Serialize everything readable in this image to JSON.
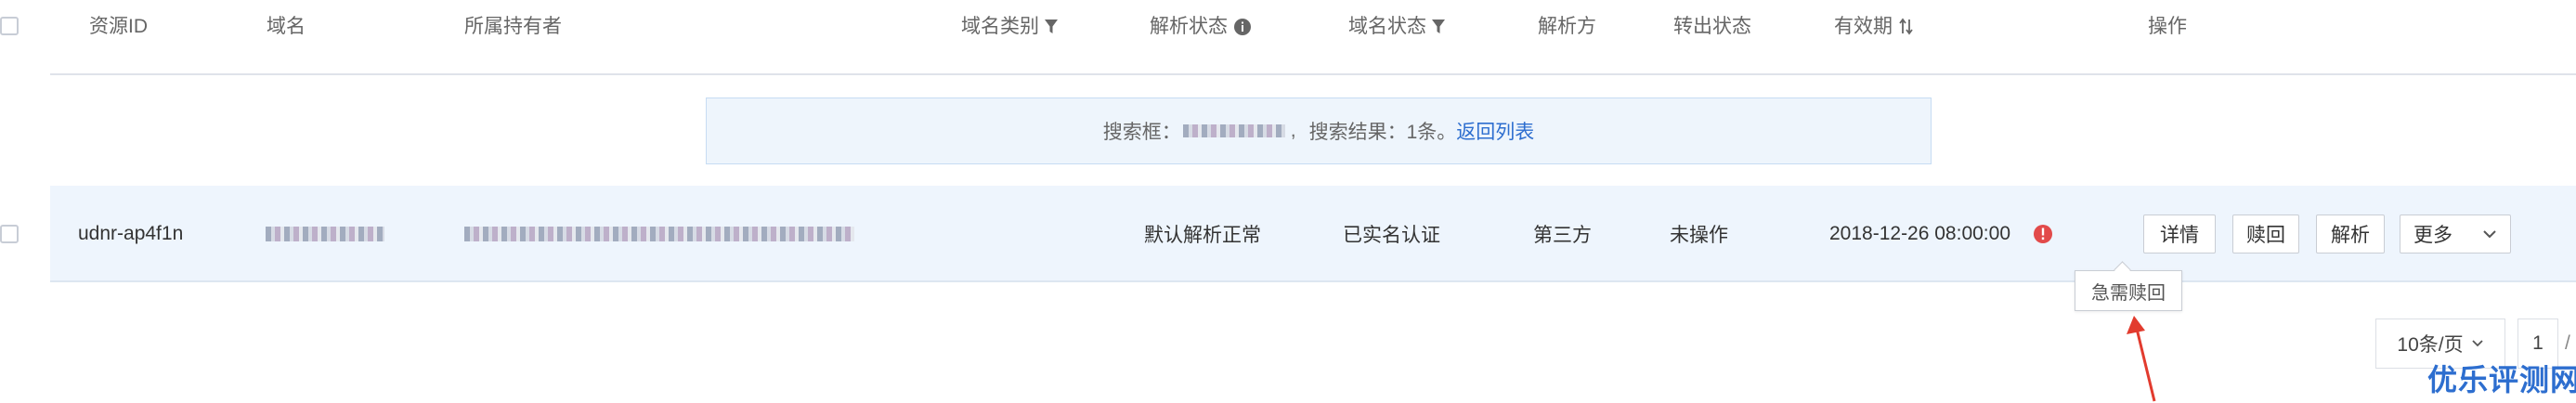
{
  "header": {
    "col_resource_id": "资源ID",
    "col_domain": "域名",
    "col_owner": "所属持有者",
    "col_domain_type": "域名类别",
    "col_dns_status": "解析状态",
    "col_domain_status": "域名状态",
    "col_dns_provider": "解析方",
    "col_transfer_status": "转出状态",
    "col_expiry": "有效期",
    "col_actions": "操作"
  },
  "search_banner": {
    "prefix": "搜索框：",
    "result_text": "搜索结果：1条。",
    "back_link": "返回列表"
  },
  "row": {
    "resource_id": "udnr-ap4f1n",
    "dns_status": "默认解析正常",
    "domain_status": "已实名认证",
    "dns_provider": "第三方",
    "transfer_status": "未操作",
    "expiry": "2018-12-26 08:00:00"
  },
  "actions": {
    "details": "详情",
    "redeem": "赎回",
    "resolve": "解析",
    "more": "更多"
  },
  "tooltip": {
    "text": "急需赎回"
  },
  "pagination": {
    "page_size": "10条/页",
    "current_page": "1",
    "total_suffix": "/"
  },
  "watermark": {
    "text": "优乐评测网"
  },
  "colors": {
    "accent": "#2d6ecf",
    "row_bg": "#eef5fd",
    "alert_red": "#e24a4a",
    "arrow_red": "#e23b2e"
  }
}
